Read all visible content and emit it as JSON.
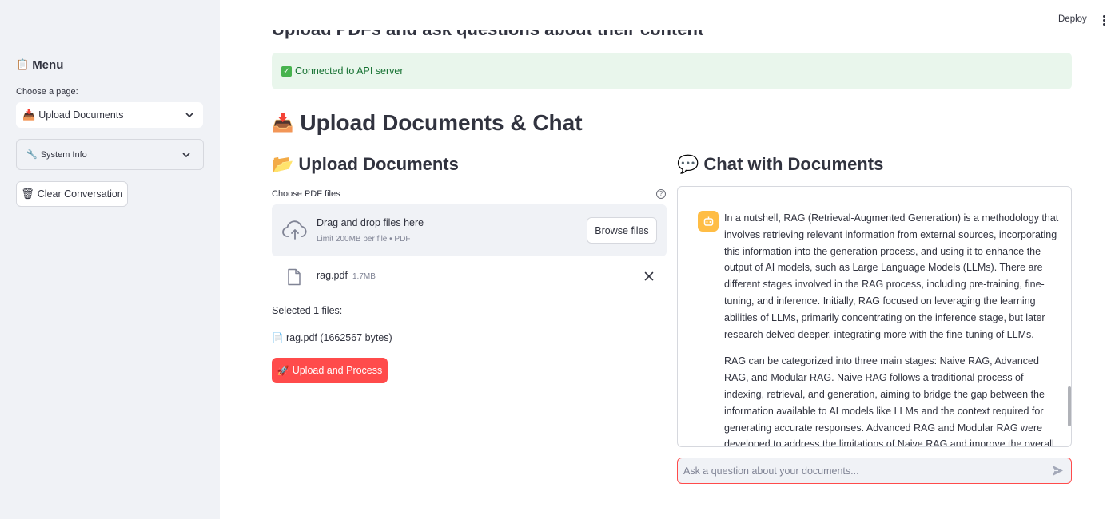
{
  "sidebar": {
    "menu_title": "Menu",
    "choose_label": "Choose a page:",
    "page_select_value": "Upload Documents",
    "system_info_label": "System Info",
    "clear_label": "Clear Conversation"
  },
  "header": {
    "deploy_label": "Deploy",
    "clipped_title": "Upload PDFs and ask questions about their content"
  },
  "status": {
    "connected_text": "Connected to API server"
  },
  "main": {
    "title": "Upload Documents & Chat",
    "upload_heading": "Upload Documents",
    "chat_heading": "Chat with Documents"
  },
  "uploader": {
    "label": "Choose PDF files",
    "dropzone_title": "Drag and drop files here",
    "dropzone_limit": "Limit 200MB per file • PDF",
    "browse_label": "Browse files",
    "file_name": "rag.pdf",
    "file_size": "1.7MB",
    "selected_text": "Selected 1 files:",
    "selected_file": "rag.pdf (1662567 bytes)",
    "upload_button": "Upload and Process"
  },
  "chat": {
    "message_p1": "In a nutshell, RAG (Retrieval-Augmented Generation) is a methodology that involves retrieving relevant information from external sources, incorporating this information into the generation process, and using it to enhance the output of AI models, such as Large Language Models (LLMs). There are different stages involved in the RAG process, including pre-training, fine-tuning, and inference. Initially, RAG focused on leveraging the learning abilities of LLMs, primarily concentrating on the inference stage, but later research delved deeper, integrating more with the fine-tuning of LLMs.",
    "message_p2": "RAG can be categorized into three main stages: Naive RAG, Advanced RAG, and Modular RAG. Naive RAG follows a traditional process of indexing, retrieval, and generation, aiming to bridge the gap between the information available to AI models like LLMs and the context required for generating accurate responses. Advanced RAG and Modular RAG were developed to address the limitations of Naive RAG and improve the overall performance",
    "input_placeholder": "Ask a question about your documents..."
  },
  "colors": {
    "primary": "#ff4b4b",
    "sidebar_bg": "#f0f2f6",
    "success_bg": "#e9f6ec",
    "success_text": "#177233",
    "bot_avatar": "#ffbd45"
  }
}
